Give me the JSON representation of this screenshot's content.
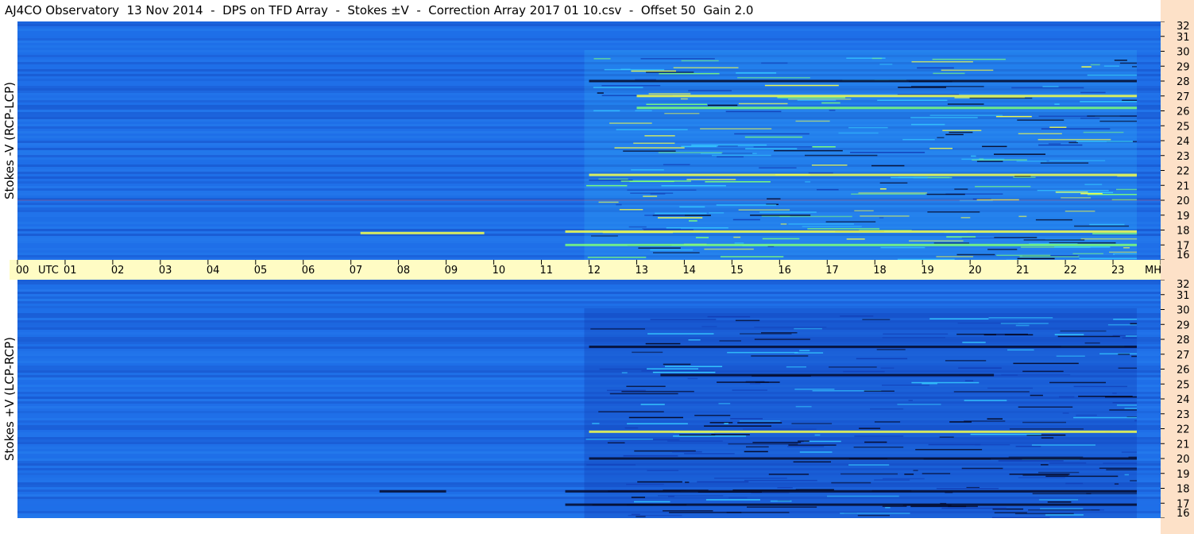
{
  "title": "AJ4CO Observatory  13 Nov 2014  -  DPS on TFD Array  -  Stokes ±V  -  Correction Array 2017 01 10.csv  -  Offset 50  Gain 2.0",
  "panels": {
    "top": {
      "label": "Stokes -V (RCP-LCP)"
    },
    "bottom": {
      "label": "Stokes +V (LCP-RCP)"
    }
  },
  "colors": {
    "background_blue": "#1f6fe8",
    "bright_band": "#2a86f2",
    "dark_blue": "#1240b8",
    "cyan": "#35c8ff",
    "green": "#7dff7a",
    "yellow": "#f6ff4a",
    "red": "#ff3b2f",
    "black": "#050a2a",
    "time_axis_bg": "#fffcc4",
    "freq_axis_bg": "#fde1c8"
  },
  "chart_data": {
    "type": "heatmap",
    "x_axis": {
      "unit_label": "UTC",
      "ticks": [
        "00",
        "01",
        "02",
        "03",
        "04",
        "05",
        "06",
        "07",
        "08",
        "09",
        "10",
        "11",
        "12",
        "13",
        "14",
        "15",
        "16",
        "17",
        "18",
        "19",
        "20",
        "21",
        "22",
        "23",
        "00"
      ],
      "range": [
        0,
        24
      ],
      "end_label": "MHz"
    },
    "y_axis": {
      "ticks": [
        "32",
        "31",
        "30",
        "29",
        "28",
        "27",
        "26",
        "25",
        "24",
        "23",
        "22",
        "21",
        "20",
        "19",
        "18",
        "17",
        "16"
      ],
      "range": [
        16,
        32
      ],
      "unit": "MHz"
    },
    "panels": [
      {
        "name": "Stokes -V (RCP-LCP)",
        "activity_start_utc": 11.9,
        "activity_end_utc": 23.5,
        "bursts": [
          {
            "utc_start": 7.2,
            "utc_end": 9.8,
            "mhz": 17.8,
            "tone": "yellow"
          },
          {
            "utc_start": 11.5,
            "utc_end": 23.5,
            "mhz": 17.9,
            "tone": "yellow"
          },
          {
            "utc_start": 11.5,
            "utc_end": 23.5,
            "mhz": 17.0,
            "tone": "green"
          },
          {
            "utc_start": 13.0,
            "utc_end": 23.5,
            "mhz": 27.0,
            "tone": "yellow"
          },
          {
            "utc_start": 13.0,
            "utc_end": 23.5,
            "mhz": 26.2,
            "tone": "green"
          },
          {
            "utc_start": 12.0,
            "utc_end": 23.5,
            "mhz": 21.7,
            "tone": "yellow"
          },
          {
            "utc_start": 12.0,
            "utc_end": 23.5,
            "mhz": 28.0,
            "tone": "black"
          }
        ]
      },
      {
        "name": "Stokes +V (LCP-RCP)",
        "activity_start_utc": 11.9,
        "activity_end_utc": 23.5,
        "bursts": [
          {
            "utc_start": 7.6,
            "utc_end": 9.0,
            "mhz": 17.8,
            "tone": "black"
          },
          {
            "utc_start": 11.5,
            "utc_end": 23.5,
            "mhz": 17.8,
            "tone": "black"
          },
          {
            "utc_start": 11.5,
            "utc_end": 23.5,
            "mhz": 16.9,
            "tone": "black"
          },
          {
            "utc_start": 13.5,
            "utc_end": 20.5,
            "mhz": 25.6,
            "tone": "black"
          },
          {
            "utc_start": 12.0,
            "utc_end": 23.5,
            "mhz": 27.5,
            "tone": "black"
          },
          {
            "utc_start": 12.0,
            "utc_end": 23.5,
            "mhz": 20.0,
            "tone": "black"
          },
          {
            "utc_start": 12.0,
            "utc_end": 23.5,
            "mhz": 21.8,
            "tone": "yellow"
          }
        ]
      }
    ]
  }
}
